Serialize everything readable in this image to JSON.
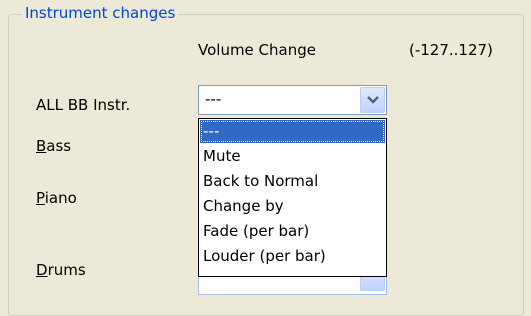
{
  "group": {
    "title": "Instrument changes"
  },
  "header": {
    "volume_change": "Volume Change",
    "range": "(-127..127)"
  },
  "rows": [
    {
      "label_first": "A",
      "label_rest": "LL BB Instr.",
      "underline": false
    },
    {
      "label_first": "B",
      "label_rest": "ass",
      "underline": true
    },
    {
      "label_first": "P",
      "label_rest": "iano",
      "underline": true
    },
    {
      "label_first": "D",
      "label_rest": "rums",
      "underline": true
    }
  ],
  "combo": {
    "selected_value": "---"
  },
  "dropdown": {
    "options": [
      "---",
      "Mute",
      "Back to Normal",
      "Change by",
      "Fade (per bar)",
      "Louder (per bar)"
    ],
    "highlighted_index": 0
  },
  "colors": {
    "title": "#0046d5",
    "highlight": "#316ac5",
    "combo_border": "#7f9db9"
  },
  "icons": {
    "combo_arrow": "chevron-down-icon"
  }
}
